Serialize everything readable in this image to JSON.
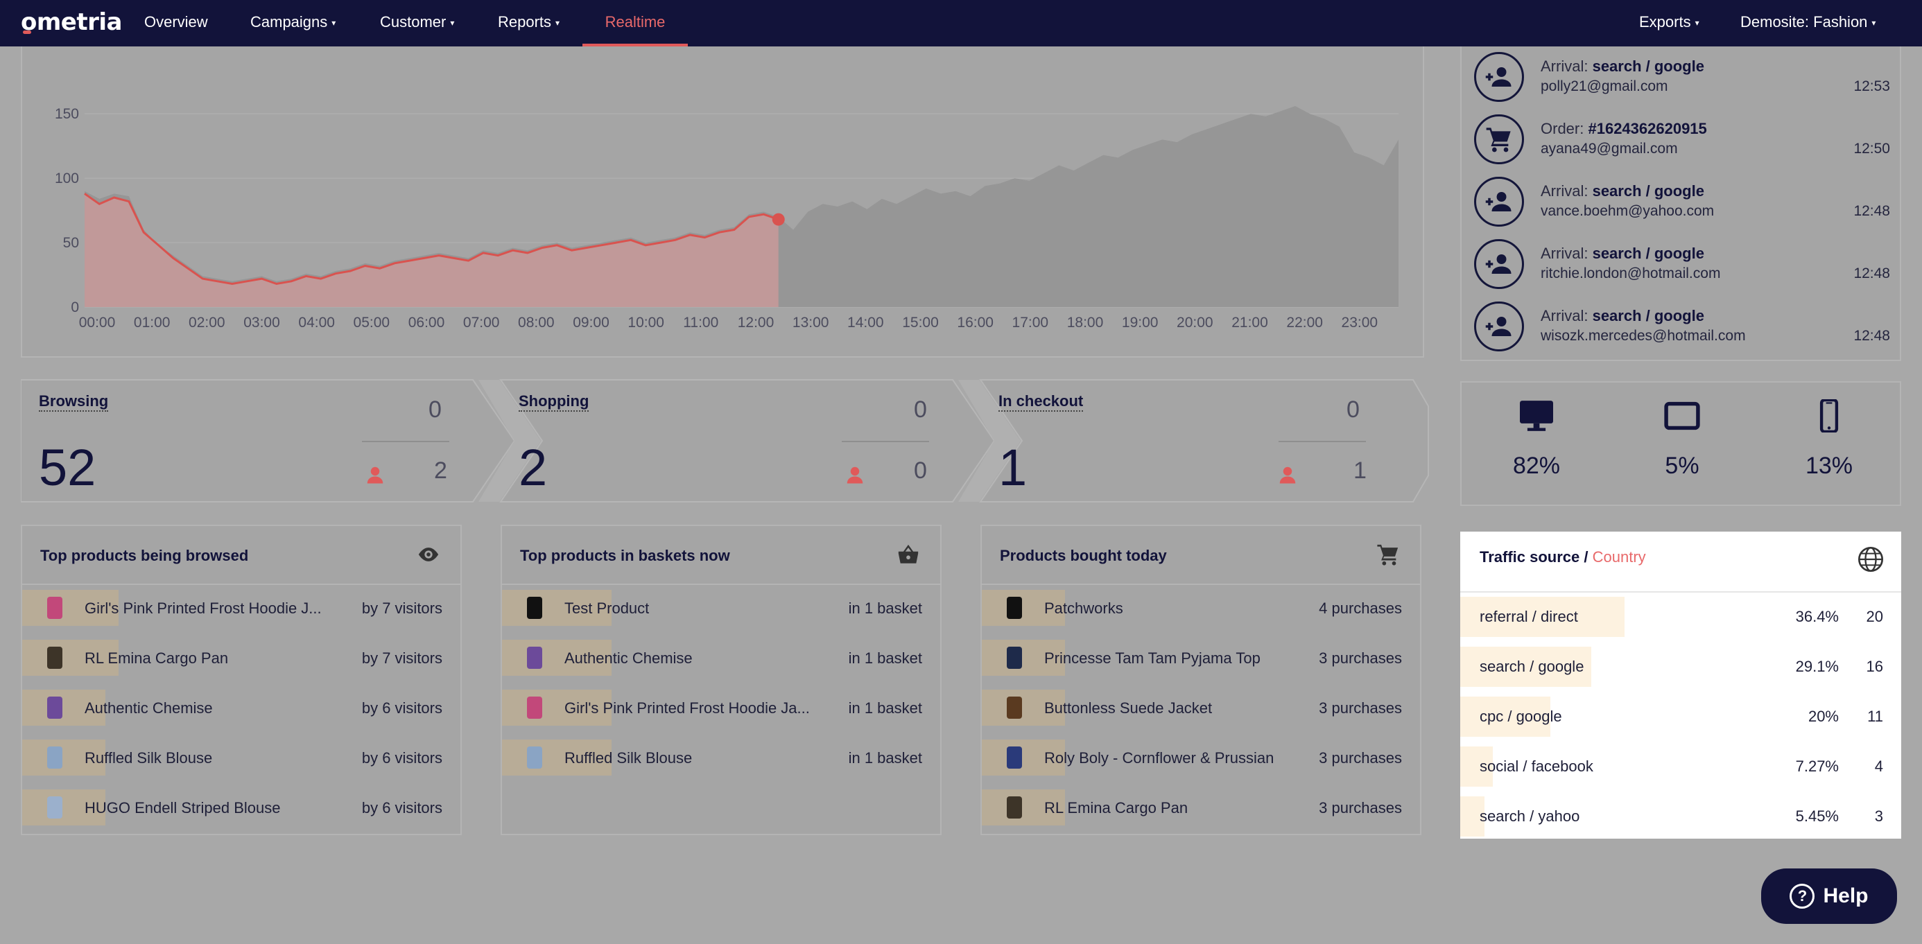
{
  "nav": {
    "logo": "ometria",
    "items": [
      "Overview",
      "Campaigns",
      "Customer",
      "Reports",
      "Realtime"
    ],
    "right": [
      "Exports",
      "Demosite: Fashion"
    ],
    "active": "Realtime"
  },
  "chart_data": {
    "type": "area",
    "x_ticks": [
      "00:00",
      "01:00",
      "02:00",
      "03:00",
      "04:00",
      "05:00",
      "06:00",
      "07:00",
      "08:00",
      "09:00",
      "10:00",
      "11:00",
      "12:00",
      "13:00",
      "14:00",
      "15:00",
      "16:00",
      "17:00",
      "18:00",
      "19:00",
      "20:00",
      "21:00",
      "22:00",
      "23:00"
    ],
    "y_ticks": [
      "0",
      "50",
      "100",
      "150"
    ],
    "ylim": [
      0,
      170
    ],
    "series": [
      {
        "values": [
          88,
          80,
          85,
          82,
          58,
          48,
          38,
          30,
          22,
          20,
          18,
          20,
          22,
          18,
          20,
          24,
          22,
          26,
          28,
          32,
          30,
          34,
          36,
          38,
          40,
          38,
          36,
          42,
          40,
          44,
          42,
          46,
          48,
          44,
          46,
          48,
          50,
          52,
          48,
          50,
          52,
          56,
          54,
          58,
          60,
          70,
          72,
          68
        ]
      },
      {
        "values": [
          90,
          84,
          88,
          86,
          60,
          48,
          40,
          32,
          24,
          22,
          20,
          22,
          24,
          20,
          22,
          26,
          24,
          28,
          30,
          34,
          32,
          36,
          38,
          40,
          42,
          40,
          38,
          44,
          42,
          46,
          44,
          48,
          50,
          46,
          48,
          50,
          52,
          54,
          50,
          52,
          54,
          58,
          56,
          60,
          62,
          72,
          74,
          70,
          60,
          74,
          80,
          78,
          82,
          76,
          84,
          80,
          86,
          92,
          88,
          90,
          86,
          94,
          96,
          100,
          98,
          104,
          110,
          106,
          112,
          118,
          116,
          122,
          126,
          130,
          128,
          134,
          138,
          142,
          146,
          150,
          148,
          152,
          156,
          150,
          146,
          140,
          120,
          116,
          110,
          130
        ]
      }
    ],
    "current_index": 47
  },
  "activity": [
    {
      "icon": "person-add-icon",
      "prefix": "Arrival:",
      "title": "search / google",
      "email": "polly21@gmail.com",
      "time": "12:53"
    },
    {
      "icon": "cart-icon",
      "prefix": "Order:",
      "title": "#1624362620915",
      "email": "ayana49@gmail.com",
      "time": "12:50"
    },
    {
      "icon": "person-add-icon",
      "prefix": "Arrival:",
      "title": "search / google",
      "email": "vance.boehm@yahoo.com",
      "time": "12:48"
    },
    {
      "icon": "person-add-icon",
      "prefix": "Arrival:",
      "title": "search / google",
      "email": "ritchie.london@hotmail.com",
      "time": "12:48"
    },
    {
      "icon": "person-add-icon",
      "prefix": "Arrival:",
      "title": "search / google",
      "email": "wisozk.mercedes@hotmail.com",
      "time": "12:48"
    }
  ],
  "funnel": [
    {
      "title": "Browsing",
      "top": "0",
      "big": "52",
      "small": "2"
    },
    {
      "title": "Shopping",
      "top": "0",
      "big": "2",
      "small": "0"
    },
    {
      "title": "In checkout",
      "top": "0",
      "big": "1",
      "small": "1"
    }
  ],
  "devices": [
    {
      "icon": "desktop-icon",
      "pct": "82%"
    },
    {
      "icon": "tablet-icon",
      "pct": "5%"
    },
    {
      "icon": "mobile-icon",
      "pct": "13%"
    }
  ],
  "browsed": {
    "title": "Top products being browsed",
    "icon": "eye-icon",
    "rows": [
      {
        "name": "Girl's Pink Printed Frost Hoodie J...",
        "meta": "by 7 visitors",
        "thumb": "#c2487a",
        "share": 0.22
      },
      {
        "name": "RL Emina Cargo Pan",
        "meta": "by 7 visitors",
        "thumb": "#3d3428",
        "share": 0.22
      },
      {
        "name": "Authentic Chemise",
        "meta": "by 6 visitors",
        "thumb": "#6c4a9a",
        "share": 0.19
      },
      {
        "name": "Ruffled Silk Blouse",
        "meta": "by 6 visitors",
        "thumb": "#8aa4c4",
        "share": 0.19
      },
      {
        "name": "HUGO Endell Striped Blouse",
        "meta": "by 6 visitors",
        "thumb": "#9bb0cc",
        "share": 0.19
      }
    ]
  },
  "baskets": {
    "title": "Top products in baskets now",
    "icon": "basket-icon",
    "rows": [
      {
        "name": "Test Product",
        "meta": "in 1 basket",
        "thumb": "#111111",
        "share": 0.25
      },
      {
        "name": "Authentic Chemise",
        "meta": "in 1 basket",
        "thumb": "#6c4a9a",
        "share": 0.25
      },
      {
        "name": "Girl's Pink Printed Frost Hoodie Ja...",
        "meta": "in 1 basket",
        "thumb": "#c2487a",
        "share": 0.25
      },
      {
        "name": "Ruffled Silk Blouse",
        "meta": "in 1 basket",
        "thumb": "#8aa4c4",
        "share": 0.25
      }
    ]
  },
  "bought": {
    "title": "Products bought today",
    "icon": "cart-icon",
    "rows": [
      {
        "name": "Patchworks",
        "meta": "4 purchases",
        "thumb": "#111111",
        "share": 0.19
      },
      {
        "name": "Princesse Tam Tam Pyjama Top",
        "meta": "3 purchases",
        "thumb": "#1e2a4a",
        "share": 0.19
      },
      {
        "name": "Buttonless Suede Jacket",
        "meta": "3 purchases",
        "thumb": "#5a3a20",
        "share": 0.19
      },
      {
        "name": "Roly Boly - Cornflower & Prussian",
        "meta": "3 purchases",
        "thumb": "#2a3a7a",
        "share": 0.19
      },
      {
        "name": "RL Emina Cargo Pan",
        "meta": "3 purchases",
        "thumb": "#3d3428",
        "share": 0.19
      }
    ]
  },
  "traffic": {
    "title": "Traffic source",
    "sep": " / ",
    "alt": "Country",
    "icon": "globe-icon",
    "rows": [
      {
        "label": "referral / direct",
        "pct": "36.4%",
        "count": "20",
        "share": 0.364
      },
      {
        "label": "search / google",
        "pct": "29.1%",
        "count": "16",
        "share": 0.291
      },
      {
        "label": "cpc / google",
        "pct": "20%",
        "count": "11",
        "share": 0.2
      },
      {
        "label": "social / facebook",
        "pct": "7.27%",
        "count": "4",
        "share": 0.0727
      },
      {
        "label": "search / yahoo",
        "pct": "5.45%",
        "count": "3",
        "share": 0.0545
      }
    ]
  },
  "help": {
    "label": "Help"
  },
  "colors": {
    "navy": "#12133a",
    "accent": "#e05a5a",
    "dim": "#a8a8a8"
  }
}
